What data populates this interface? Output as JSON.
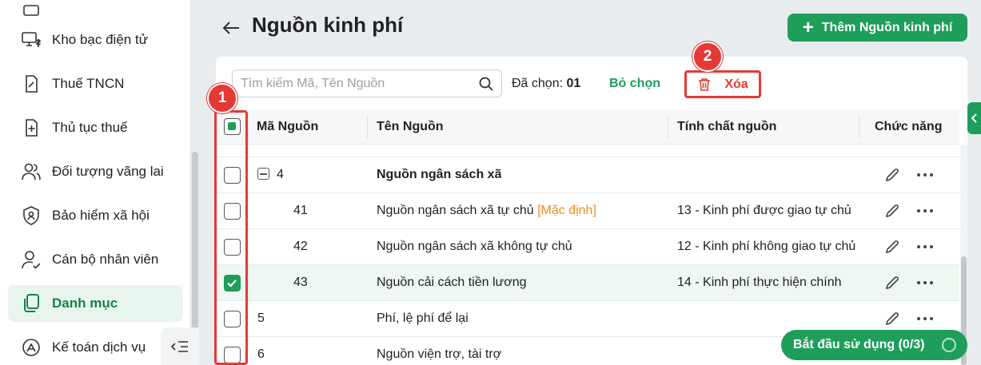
{
  "sidebar": {
    "items": [
      {
        "label": "Kho bạc điện tử",
        "icon": "monitor-dollar-icon"
      },
      {
        "label": "Thuế TNCN",
        "icon": "tax-document-icon"
      },
      {
        "label": "Thủ tục thuế",
        "icon": "document-plus-icon"
      },
      {
        "label": "Đối tượng vãng lai",
        "icon": "users-icon"
      },
      {
        "label": "Bảo hiểm xã hội",
        "icon": "shield-user-icon"
      },
      {
        "label": "Cán bộ nhân viên",
        "icon": "user-check-icon"
      },
      {
        "label": "Danh mục",
        "icon": "copy-icon",
        "active": true
      },
      {
        "label": "Kế toán dịch vụ",
        "icon": "accounting-icon"
      }
    ]
  },
  "header": {
    "title": "Nguồn kinh phí",
    "add_button": "Thêm Nguồn kinh phí"
  },
  "toolbar": {
    "search_placeholder": "Tìm kiếm Mã, Tên Nguồn",
    "selected_label": "Đã chọn:",
    "selected_count": "01",
    "deselect_label": "Bỏ chọn",
    "delete_label": "Xóa"
  },
  "table": {
    "columns": [
      "Mã Nguồn",
      "Tên Nguồn",
      "Tính chất nguồn",
      "Chức năng"
    ],
    "rows": [
      {
        "code": "4",
        "name": "Nguồn ngân sách xã",
        "nature": "",
        "group": true,
        "checked": false
      },
      {
        "code": "41",
        "name": "Nguồn ngân sách xã tự chủ",
        "tag": "[Mặc định]",
        "nature": "13 - Kinh phí được giao tự chủ",
        "checked": false
      },
      {
        "code": "42",
        "name": "Nguồn ngân sách xã không tự chủ",
        "nature": "12 - Kinh phí không giao tự chủ",
        "checked": false
      },
      {
        "code": "43",
        "name": "Nguồn cải cách tiền lương",
        "nature": "14 - Kinh phí thực hiện chính",
        "checked": true
      },
      {
        "code": "5",
        "name": "Phí, lệ phí để lại",
        "nature": "",
        "checked": false
      },
      {
        "code": "6",
        "name": "Nguồn viện trợ, tài trợ",
        "nature": "",
        "checked": false
      }
    ]
  },
  "annotations": {
    "badge_1": "1",
    "badge_2": "2"
  },
  "onboarding": {
    "label": "Bắt đầu sử dụng (0/3)"
  },
  "colors": {
    "primary": "#1e9e5a",
    "danger": "#e53935",
    "tag": "#f08c1f"
  }
}
